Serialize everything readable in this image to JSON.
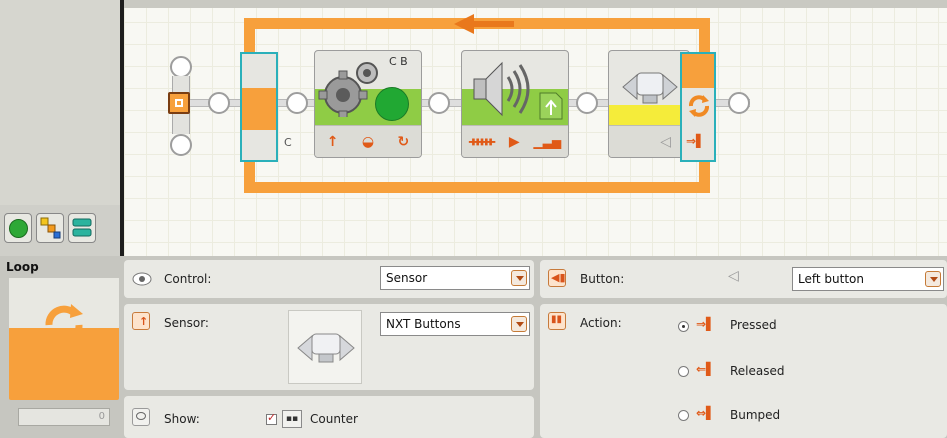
{
  "canvas": {
    "loop_block": {
      "port_label": "C"
    },
    "motor_block": {
      "ports_label": "C B"
    }
  },
  "panel": {
    "block_title": "Loop",
    "count_value": "0",
    "control": {
      "label": "Control:",
      "value": "Sensor"
    },
    "sensor": {
      "label": "Sensor:",
      "value": "NXT Buttons"
    },
    "show": {
      "label": "Show:",
      "counter_label": "Counter",
      "counter_checked": true
    },
    "button": {
      "label": "Button:",
      "value": "Left button"
    },
    "action": {
      "label": "Action:",
      "options": [
        {
          "label": "Pressed",
          "selected": true
        },
        {
          "label": "Released",
          "selected": false
        },
        {
          "label": "Bumped",
          "selected": false
        }
      ]
    }
  }
}
